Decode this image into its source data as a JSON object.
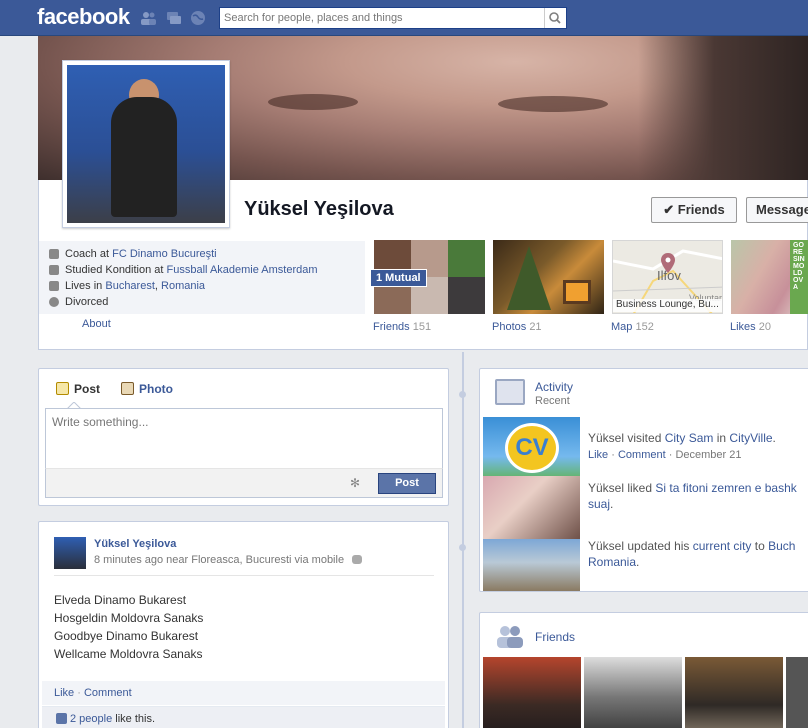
{
  "topbar": {
    "logo": "facebook",
    "search_placeholder": "Search for people, places and things"
  },
  "profile": {
    "name": "Yüksel Yeşilova",
    "friends_button": "✔ Friends",
    "message_button": "Message"
  },
  "info": {
    "work_prefix": "Coach at ",
    "work_link": "FC Dinamo Bucureşti",
    "study_prefix": "Studied Kondition at ",
    "study_link": "Fussball Akademie Amsterdam",
    "lives_prefix": "Lives in ",
    "lives_city": "Bucharest",
    "lives_sep": ", ",
    "lives_country": "Romania",
    "relationship": "Divorced",
    "about": "About"
  },
  "thumbs": {
    "mutual": "1 Mutual",
    "friends_label": "Friends",
    "friends_count": "151",
    "photos_label": "Photos",
    "photos_count": "21",
    "map_label": "Map",
    "map_count": "152",
    "map_city": "Ilfov",
    "map_place": "Business Lounge, Bu...",
    "map_extra": "Voluntari",
    "likes_label": "Likes",
    "likes_count": "20",
    "likes_banner": "GORESINMOLDOVA"
  },
  "composer": {
    "tab_post": "Post",
    "tab_photo": "Photo",
    "placeholder": "Write something...",
    "post_button": "Post"
  },
  "status": {
    "author": "Yüksel Yeşilova",
    "meta": "8 minutes ago near Floreasca, Bucuresti via mobile",
    "lines": [
      "Elveda Dinamo Bukarest",
      "Hosgeldin Moldovra Sanaks",
      "Goodbye Dinamo Bukarest",
      "Wellcame Moldovra Sanaks"
    ],
    "like": "Like",
    "dot": " · ",
    "comment": "Comment",
    "likes_people": "2 people",
    "likes_suffix": " like this."
  },
  "activity": {
    "title": "Activity",
    "subtitle": "Recent",
    "item1": {
      "prefix": "Yüksel visited ",
      "link1": "City Sam",
      "mid": " in ",
      "link2": "CityVille",
      "suffix": ".",
      "like": "Like",
      "comment": "Comment",
      "date": "December 21",
      "cv": "CV"
    },
    "item2": {
      "prefix": "Yüksel liked ",
      "link1": "Si ta fitoni zemren e bashk",
      "link1b": "suaj",
      "suffix": "."
    },
    "item3": {
      "prefix": "Yüksel updated his ",
      "link1": "current city",
      "mid": " to ",
      "link2": "Buch",
      "link2b": "Romania",
      "suffix": "."
    }
  },
  "friends_widget": {
    "title": "Friends"
  },
  "colors": {
    "brand": "#3b5998",
    "border": "#c4cde0",
    "button_blue": "#5b74a8"
  }
}
